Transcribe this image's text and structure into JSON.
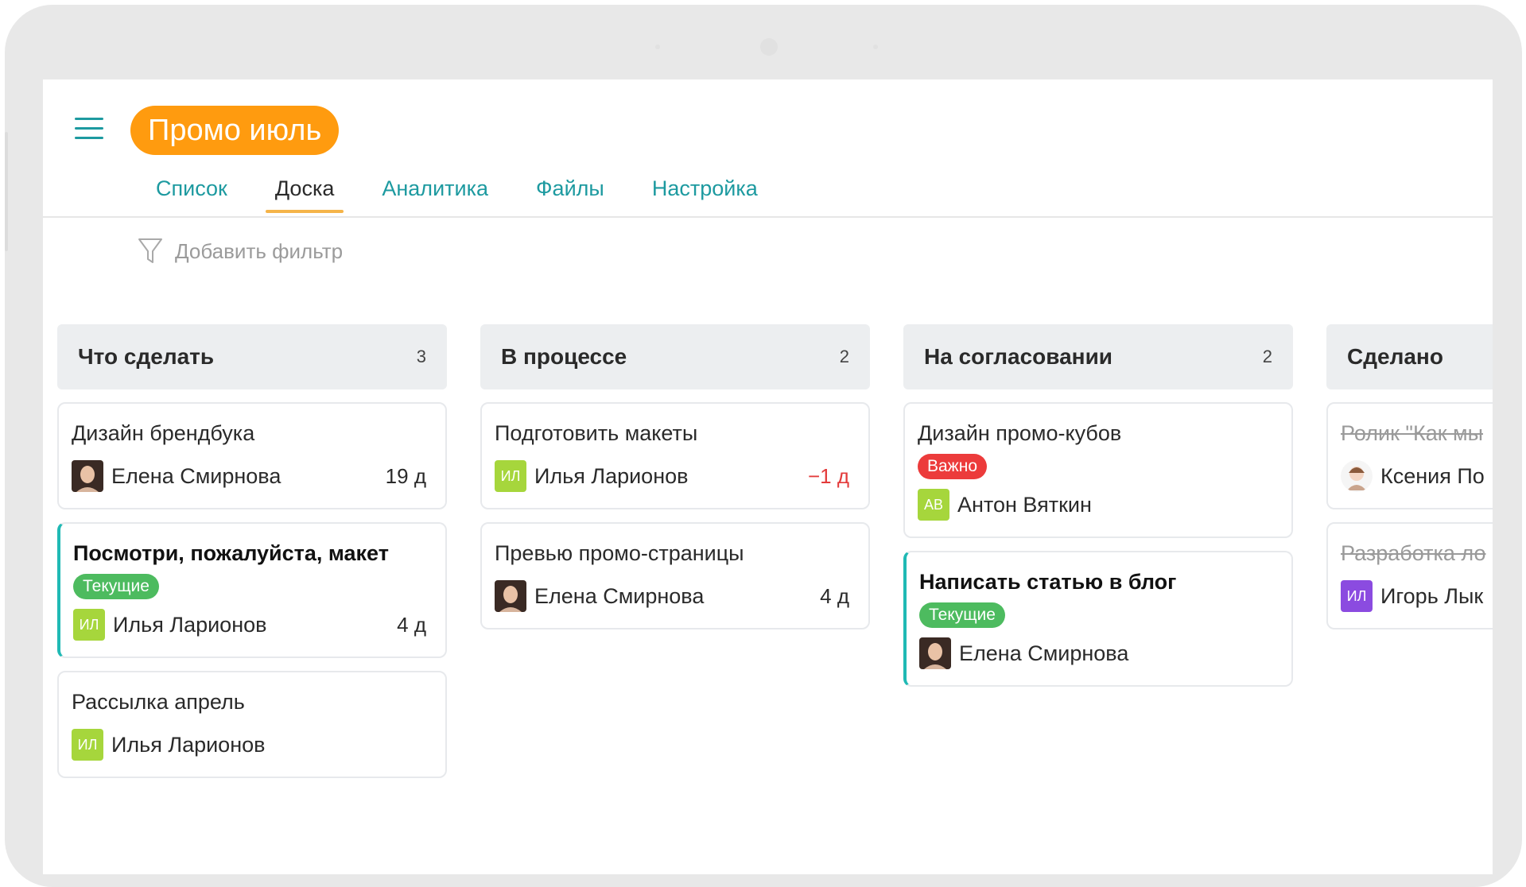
{
  "project": {
    "name": "Промо июль"
  },
  "tabs": [
    {
      "label": "Список"
    },
    {
      "label": "Доска"
    },
    {
      "label": "Аналитика"
    },
    {
      "label": "Файлы"
    },
    {
      "label": "Настройка"
    }
  ],
  "active_tab": "Доска",
  "filter": {
    "label": "Добавить фильтр"
  },
  "columns": [
    {
      "title": "Что сделать",
      "count": "3",
      "cards": [
        {
          "title": "Дизайн брендбука",
          "assignee": "Елена Смирнова",
          "due": "19 д"
        },
        {
          "title": "Посмотри, пожалуйста, макет",
          "tag": "Текущие",
          "assignee": "Илья Ларионов",
          "initials": "ИЛ",
          "due": "4 д"
        },
        {
          "title": "Рассылка апрель",
          "assignee": "Илья Ларионов",
          "initials": "ИЛ"
        }
      ]
    },
    {
      "title": "В процессе",
      "count": "2",
      "cards": [
        {
          "title": "Подготовить макеты",
          "assignee": "Илья Ларионов",
          "initials": "ИЛ",
          "due": "−1 д"
        },
        {
          "title": "Превью промо-страницы",
          "assignee": "Елена Смирнова",
          "due": "4 д"
        }
      ]
    },
    {
      "title": "На согласовании",
      "count": "2",
      "cards": [
        {
          "title": "Дизайн промо-кубов",
          "tag": "Важно",
          "assignee": "Антон Вяткин",
          "initials": "АВ"
        },
        {
          "title": "Написать статью в блог",
          "tag": "Текущие",
          "assignee": "Елена Смирнова"
        }
      ]
    },
    {
      "title": "Сделано",
      "cards": [
        {
          "title": "Ролик \"Как мы",
          "assignee": "Ксения По"
        },
        {
          "title": "Разработка ло",
          "assignee": "Игорь Лык",
          "initials": "ИЛ"
        }
      ]
    }
  ],
  "colors": {
    "brand_orange": "#ff9b0f",
    "teal": "#1d9aa0",
    "tag_green": "#4dbb5f",
    "tag_red": "#ec3b3b",
    "avatar_lime": "#a6d63c",
    "avatar_purple": "#8b4be0"
  }
}
